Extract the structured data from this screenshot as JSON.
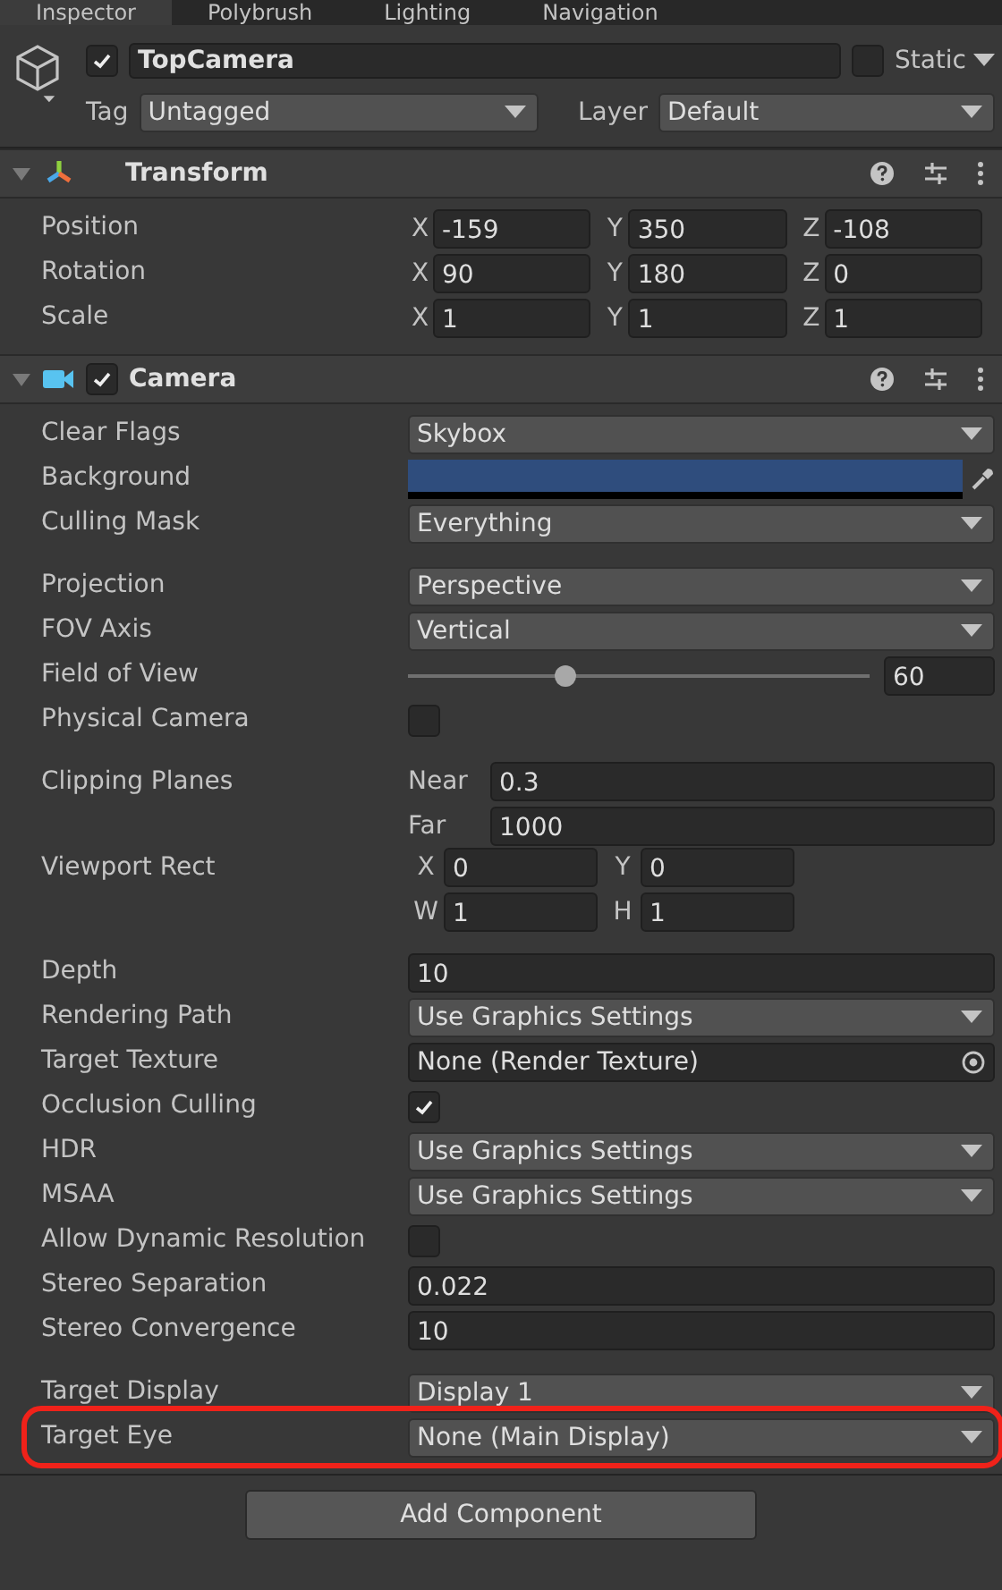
{
  "tabs": [
    {
      "label": "Inspector",
      "selected": true
    },
    {
      "label": "Polybrush",
      "selected": false
    },
    {
      "label": "Lighting",
      "selected": false
    },
    {
      "label": "Navigation",
      "selected": false
    }
  ],
  "object": {
    "active": true,
    "name": "TopCamera",
    "static": false,
    "static_label": "Static",
    "tag_label": "Tag",
    "tag": "Untagged",
    "layer_label": "Layer",
    "layer": "Default"
  },
  "components": [
    {
      "title": "Transform",
      "kind": "transform",
      "expanded": true,
      "rows": [
        {
          "label": "Position",
          "kind": "vector",
          "axes": [
            {
              "label": "X",
              "value": "-159"
            },
            {
              "label": "Y",
              "value": "350"
            },
            {
              "label": "Z",
              "value": "-108"
            }
          ]
        },
        {
          "label": "Rotation",
          "kind": "vector",
          "axes": [
            {
              "label": "X",
              "value": "90"
            },
            {
              "label": "Y",
              "value": "180"
            },
            {
              "label": "Z",
              "value": "0"
            }
          ]
        },
        {
          "label": "Scale",
          "kind": "vector",
          "axes": [
            {
              "label": "X",
              "value": "1"
            },
            {
              "label": "Y",
              "value": "1"
            },
            {
              "label": "Z",
              "value": "1"
            }
          ]
        }
      ]
    },
    {
      "title": "Camera",
      "kind": "camera",
      "expanded": true,
      "enabled": true,
      "rows": [
        {
          "label": "Clear Flags",
          "kind": "dropdown",
          "value": "Skybox"
        },
        {
          "label": "Background",
          "kind": "color",
          "color": "#2f4d7d"
        },
        {
          "label": "Culling Mask",
          "kind": "dropdown",
          "value": "Everything"
        },
        {
          "label": "Projection",
          "kind": "dropdown",
          "value": "Perspective",
          "gap": true
        },
        {
          "label": "FOV Axis",
          "kind": "dropdown",
          "value": "Vertical"
        },
        {
          "label": "Field of View",
          "kind": "slider",
          "level": 0.34,
          "value": "60"
        },
        {
          "label": "Physical Camera",
          "kind": "checkbox",
          "checked": false
        },
        {
          "label": "Clipping Planes",
          "kind": "named_fields",
          "gap": true,
          "fields": [
            {
              "label": "Near",
              "value": "0.3"
            },
            {
              "label": "Far",
              "value": "1000"
            }
          ]
        },
        {
          "label": "Viewport Rect",
          "kind": "rect",
          "lines": [
            [
              {
                "label": "X",
                "value": "0"
              },
              {
                "label": "Y",
                "value": "0"
              }
            ],
            [
              {
                "label": "W",
                "value": "1"
              },
              {
                "label": "H",
                "value": "1"
              }
            ]
          ]
        },
        {
          "label": "Depth",
          "kind": "field",
          "value": "10",
          "gap": true
        },
        {
          "label": "Rendering Path",
          "kind": "dropdown",
          "value": "Use Graphics Settings"
        },
        {
          "label": "Target Texture",
          "kind": "object",
          "value": "None (Render Texture)"
        },
        {
          "label": "Occlusion Culling",
          "kind": "checkbox",
          "checked": true
        },
        {
          "label": "HDR",
          "kind": "dropdown",
          "value": "Use Graphics Settings"
        },
        {
          "label": "MSAA",
          "kind": "dropdown",
          "value": "Use Graphics Settings"
        },
        {
          "label": "Allow Dynamic Resolution",
          "kind": "checkbox",
          "checked": false
        },
        {
          "label": "Stereo Separation",
          "kind": "field",
          "value": "0.022"
        },
        {
          "label": "Stereo Convergence",
          "kind": "field",
          "value": "10"
        },
        {
          "label": "Target Display",
          "kind": "dropdown",
          "value": "Display 1",
          "gap": true
        },
        {
          "label": "Target Eye",
          "kind": "dropdown",
          "value": "None (Main Display)",
          "highlighted": true
        }
      ]
    }
  ],
  "add_button": "Add Component"
}
